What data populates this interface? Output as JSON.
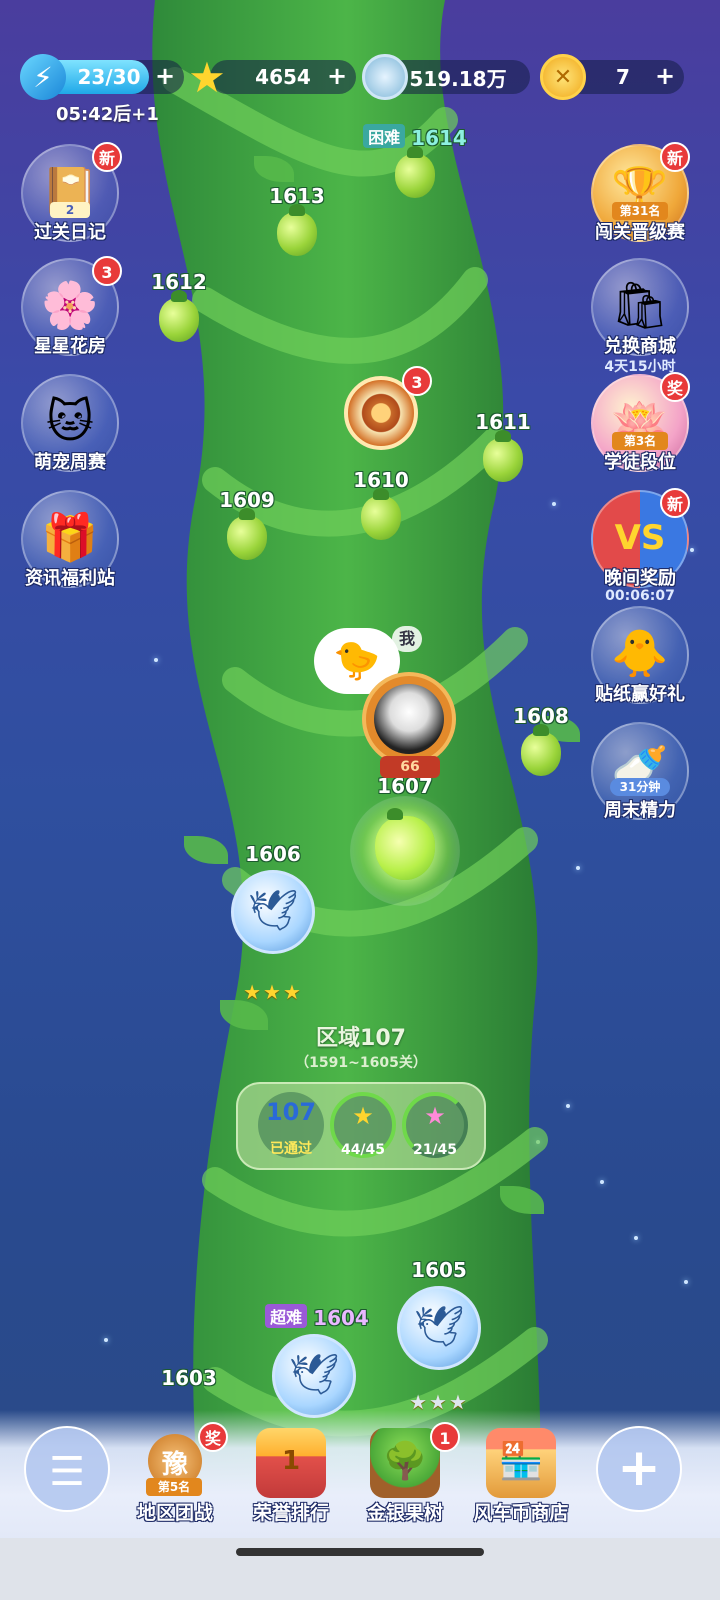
{
  "status": {
    "energy_value": "23/30",
    "energy_fraction": 0.7667,
    "stars_value": "4654",
    "coins_value": "519.18万",
    "tickets_value": "7",
    "energy_timer": "05:42后+1"
  },
  "left_buttons": [
    {
      "label": "过关日记",
      "badge": "新",
      "count": "2"
    },
    {
      "label": "星星花房",
      "badge": "3"
    },
    {
      "label": "萌宠周赛"
    },
    {
      "label": "资讯福利站"
    }
  ],
  "right_buttons": [
    {
      "label": "闯关晋级赛",
      "badge": "新",
      "rank": "第31名"
    },
    {
      "label": "兑换商城",
      "sub": "4天15小时"
    },
    {
      "label": "学徒段位",
      "badge": "奖",
      "rank": "第3名"
    },
    {
      "label": "晚间奖励",
      "badge": "新",
      "sub": "00:06:07"
    },
    {
      "label": "贴纸赢好礼"
    },
    {
      "label": "周末精力",
      "sub_tag": "31分钟"
    }
  ],
  "levels": {
    "l1614": {
      "num": "1614",
      "tag": "困难"
    },
    "l1613": {
      "num": "1613"
    },
    "l1612": {
      "num": "1612"
    },
    "l1611": {
      "num": "1611"
    },
    "l1610": {
      "num": "1610"
    },
    "l1609": {
      "num": "1609"
    },
    "l1608": {
      "num": "1608"
    },
    "l1607": {
      "num": "1607"
    },
    "l1606": {
      "num": "1606",
      "stars": "★★★"
    },
    "l1605": {
      "num": "1605",
      "stars": "★★★"
    },
    "l1604": {
      "num": "1604",
      "tag": "超难"
    },
    "l1603": {
      "num": "1603"
    }
  },
  "wheel_badge": "3",
  "player": {
    "me_tag": "我",
    "level": "66"
  },
  "region": {
    "title": "区域107",
    "range": "（1591~1605关）",
    "stats": [
      {
        "top": "107",
        "bottom": "已通过"
      },
      {
        "top": "★",
        "bottom": "44/45"
      },
      {
        "top": "★",
        "bottom": "21/45"
      }
    ]
  },
  "bottom_nav": [
    {
      "label": "地区团战",
      "badge": "奖",
      "rank": "第5名",
      "glyph": "豫"
    },
    {
      "label": "荣誉排行",
      "glyph": "1"
    },
    {
      "label": "金银果树",
      "badge": "1"
    },
    {
      "label": "风车币商店"
    }
  ],
  "colors": {
    "accent_green": "#57b94a",
    "badge_red": "#e83a3a",
    "energy_blue": "#1fa8e8",
    "star_gold": "#ffd52e"
  }
}
